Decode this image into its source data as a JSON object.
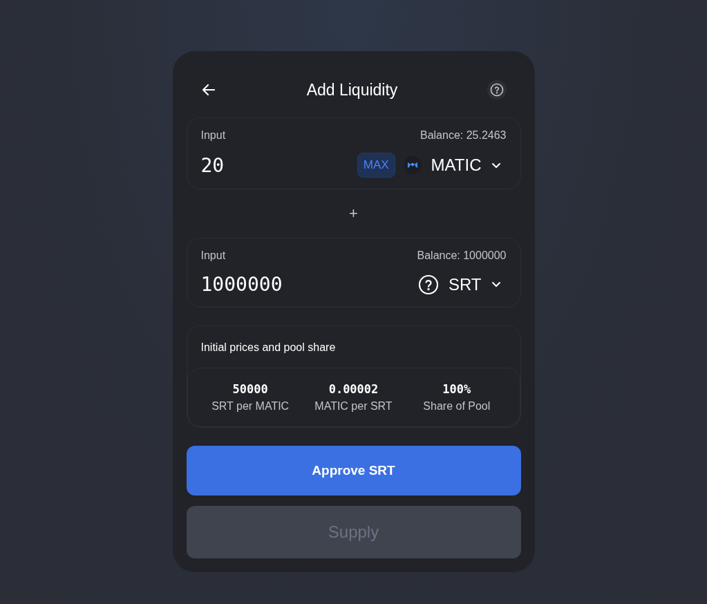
{
  "header": {
    "title": "Add Liquidity"
  },
  "inputs": [
    {
      "label": "Input",
      "balance": "Balance: 25.2463",
      "value": "20",
      "max": "MAX",
      "token": "MATIC",
      "token_icon": {
        "kind": "matic"
      }
    },
    {
      "label": "Input",
      "balance": "Balance: 1000000",
      "value": "1000000",
      "token": "SRT",
      "token_icon": {
        "kind": "unknown"
      }
    }
  ],
  "separator": "+",
  "prices": {
    "title": "Initial prices and pool share",
    "stats": [
      {
        "value": "50000",
        "label": "SRT per MATIC"
      },
      {
        "value": "0.00002",
        "label": "MATIC per SRT"
      },
      {
        "value": "100%",
        "label": "Share of Pool"
      }
    ]
  },
  "buttons": [
    {
      "label": "Approve SRT",
      "disabled": false
    },
    {
      "label": "Supply",
      "disabled": true
    }
  ]
}
